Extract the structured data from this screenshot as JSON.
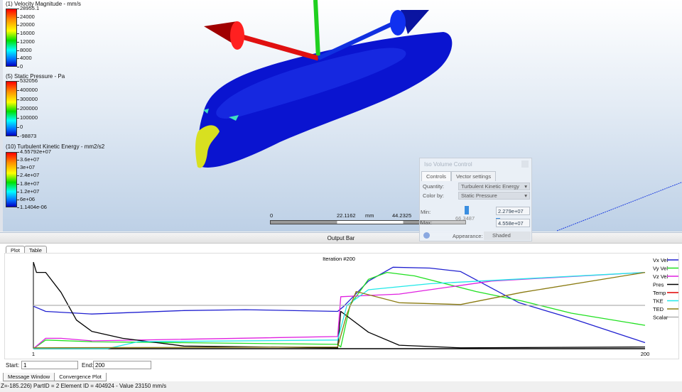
{
  "legends": [
    {
      "title": "(1) Velocity Magnitude - mm/s",
      "ticks": [
        "28955.1",
        "24000",
        "20000",
        "16000",
        "12000",
        "8000",
        "4000",
        "0"
      ]
    },
    {
      "title": "(5) Static Pressure - Pa",
      "ticks": [
        "532056",
        "400000",
        "300000",
        "200000",
        "100000",
        "0",
        "-98873"
      ]
    },
    {
      "title": "(10) Turbulent Kinetic Energy - mm2/s2",
      "ticks": [
        "4.55792e+07",
        "3.6e+07",
        "3e+07",
        "2.4e+07",
        "1.8e+07",
        "1.2e+07",
        "6e+06",
        "1.1404e-06"
      ]
    }
  ],
  "scale_bar": {
    "left": "0",
    "mid": "22.1162",
    "unit": "mm",
    "right": "44.2325"
  },
  "iso_volume": {
    "title": "Iso Volume Control",
    "tabs": [
      "Controls",
      "Vector settings"
    ],
    "quantity_label": "Quantity:",
    "quantity_value": "Turbulent Kinetic Energy",
    "colorby_label": "Color by:",
    "colorby_value": "Static Pressure",
    "min_label": "Min:",
    "min_value": "2.279e+07",
    "slider_readout": "66.3487",
    "max_label": "Max:",
    "max_value": "4.558e+07",
    "appearance_label": "Appearance:",
    "appearance_value": "Shaded",
    "help_icon": "help-icon"
  },
  "output_bar": {
    "title": "Output Bar",
    "tabs": [
      "Plot",
      "Table"
    ],
    "bottom_tabs": [
      "Message Window",
      "Convergence Plot"
    ]
  },
  "range": {
    "start_label": "Start:",
    "start_value": "1",
    "end_label": "End:",
    "end_value": "200"
  },
  "status": "Z=-185.226) PartID = 2 Element ID = 404924 - Value 23150  mm/s",
  "chart_data": {
    "type": "line",
    "title": "Iteration #200",
    "x_tick_labels": [
      "1",
      "200"
    ],
    "xlim": [
      1,
      200
    ],
    "ylim": [
      0,
      100
    ],
    "grid": false,
    "legend_placement": "right",
    "series": [
      {
        "name": "Vx Vel",
        "color": "#2020d0",
        "points": [
          [
            1,
            49
          ],
          [
            5,
            43
          ],
          [
            20,
            40
          ],
          [
            50,
            44
          ],
          [
            70,
            45
          ],
          [
            100,
            43
          ],
          [
            102,
            49
          ],
          [
            110,
            78
          ],
          [
            118,
            94
          ],
          [
            130,
            93
          ],
          [
            140,
            89
          ],
          [
            159,
            53
          ],
          [
            176,
            35
          ],
          [
            200,
            7
          ]
        ]
      },
      {
        "name": "Vy Vel",
        "color": "#20e020",
        "points": [
          [
            1,
            0
          ],
          [
            5,
            10
          ],
          [
            20,
            8
          ],
          [
            100,
            5
          ],
          [
            101,
            2
          ],
          [
            104,
            50
          ],
          [
            110,
            80
          ],
          [
            116,
            88
          ],
          [
            125,
            84
          ],
          [
            145,
            66
          ],
          [
            160,
            55
          ],
          [
            176,
            41
          ],
          [
            200,
            27
          ]
        ]
      },
      {
        "name": "Vz Vel",
        "color": "#e020e0",
        "points": [
          [
            1,
            0
          ],
          [
            5,
            12
          ],
          [
            10,
            12
          ],
          [
            20,
            9
          ],
          [
            100,
            14
          ],
          [
            101,
            60
          ],
          [
            120,
            63
          ],
          [
            150,
            78
          ],
          [
            200,
            88
          ]
        ]
      },
      {
        "name": "Pres",
        "color": "#000000",
        "points": [
          [
            1,
            100
          ],
          [
            2,
            88
          ],
          [
            5,
            88
          ],
          [
            10,
            65
          ],
          [
            15,
            33
          ],
          [
            20,
            20
          ],
          [
            30,
            12
          ],
          [
            50,
            3
          ],
          [
            100,
            1
          ],
          [
            101,
            43
          ],
          [
            110,
            19
          ],
          [
            120,
            4
          ],
          [
            140,
            1
          ],
          [
            200,
            2
          ]
        ]
      },
      {
        "name": "Temp",
        "color": "#e00000",
        "points": []
      },
      {
        "name": "TKE",
        "color": "#20e8e8",
        "points": [
          [
            1,
            0
          ],
          [
            25,
            0
          ],
          [
            35,
            8
          ],
          [
            100,
            10
          ],
          [
            103,
            50
          ],
          [
            110,
            68
          ],
          [
            130,
            75
          ],
          [
            200,
            88
          ]
        ]
      },
      {
        "name": "TED",
        "color": "#8a7a10",
        "points": [
          [
            1,
            1
          ],
          [
            100,
            2
          ],
          [
            103,
            40
          ],
          [
            106,
            66
          ],
          [
            120,
            53
          ],
          [
            140,
            51
          ],
          [
            160,
            65
          ],
          [
            200,
            88
          ]
        ]
      },
      {
        "name": "Scalar",
        "color": "#b0b0b0",
        "points": [
          [
            1,
            50
          ],
          [
            200,
            50
          ]
        ]
      }
    ]
  }
}
